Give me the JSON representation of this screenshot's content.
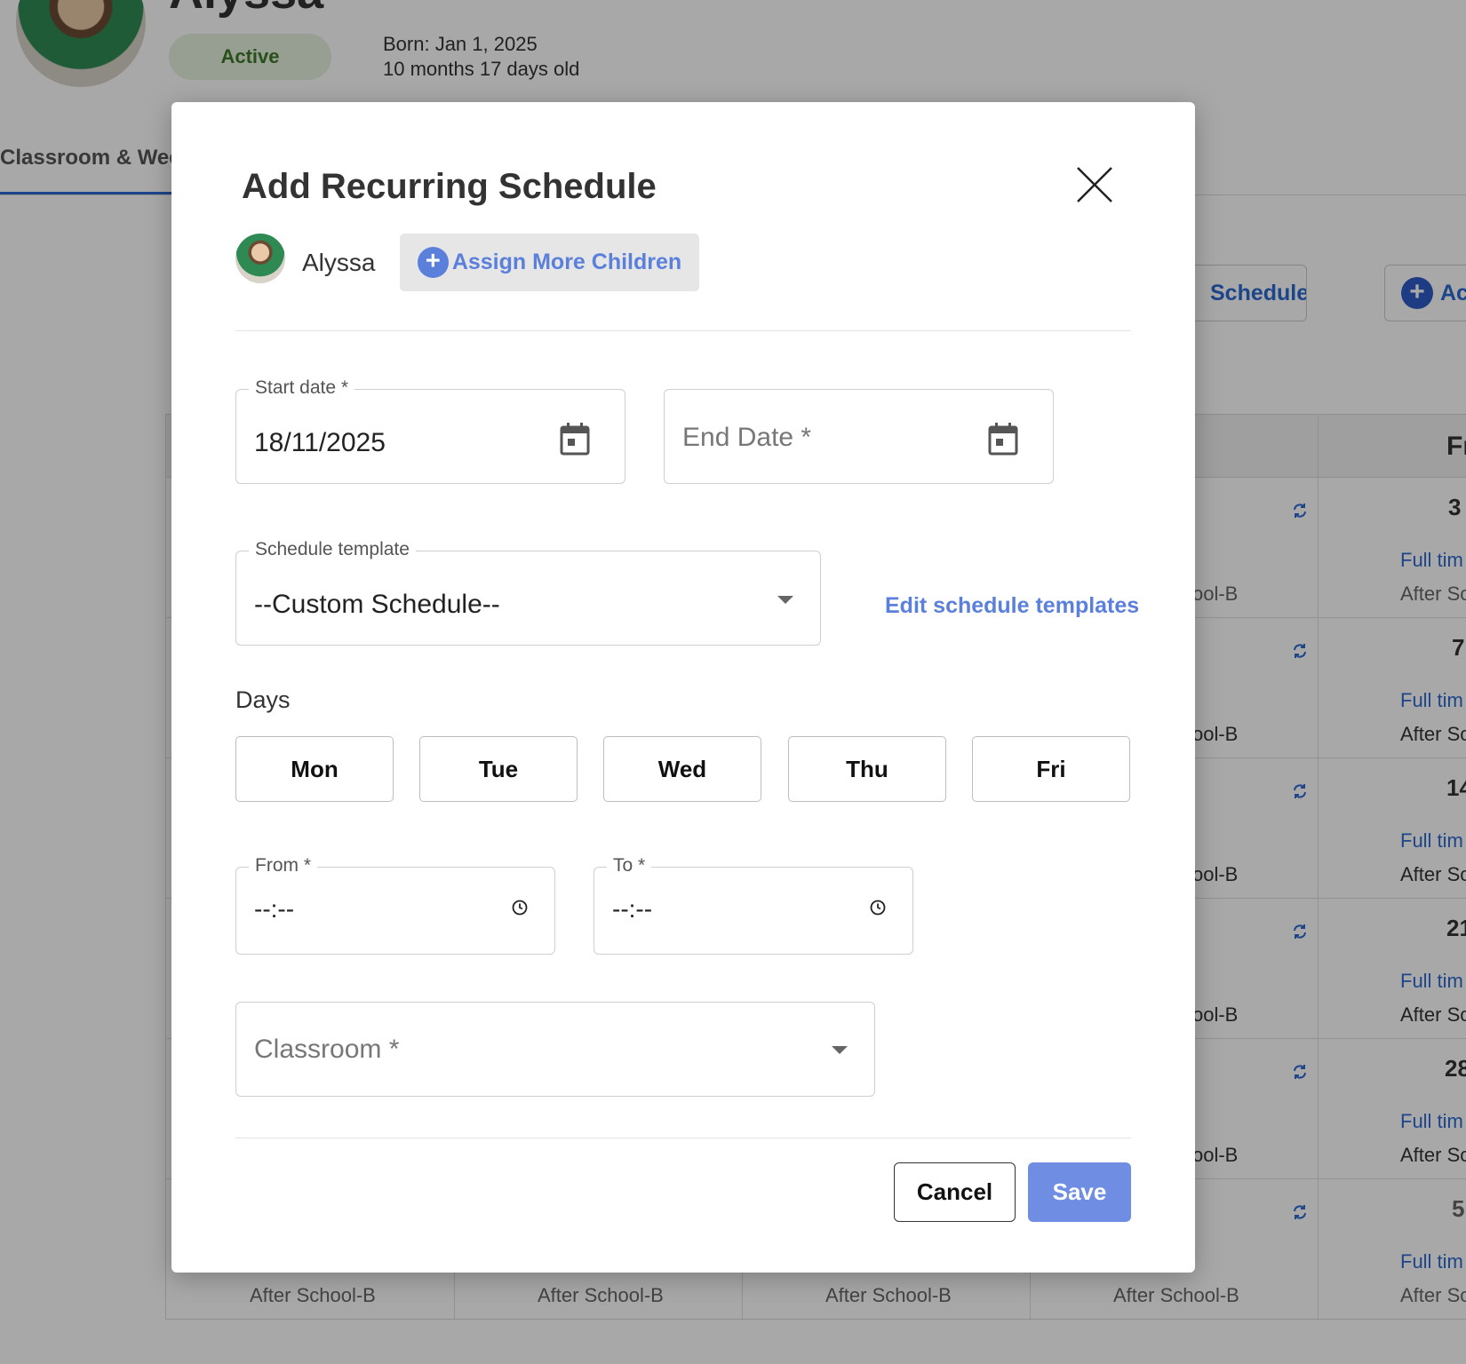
{
  "background": {
    "child_name": "Alyssa",
    "status": "Active",
    "born": "Born: Jan 1, 2025",
    "age": "10 months 17 days old",
    "tab_label": "Classroom & Wee",
    "schedule_button_label": "Schedule",
    "add_button_label": "Ac",
    "friday_header": "Fr",
    "day_numbers": [
      "3",
      "7",
      "14",
      "21",
      "28",
      "5"
    ],
    "cell_program": "Full tim",
    "cell_session": "After Sc",
    "cell_classroom_partial": "ool-B",
    "bottom_row_classrooms": [
      "After School-B",
      "After School-B",
      "After School-B",
      "After School-B"
    ]
  },
  "modal": {
    "title": "Add Recurring Schedule",
    "child_name": "Alyssa",
    "assign_more_label": "Assign More Children",
    "start_date": {
      "label": "Start date *",
      "value": "18/11/2025"
    },
    "end_date": {
      "placeholder": "End Date *"
    },
    "schedule_template": {
      "label": "Schedule template",
      "value": "--Custom Schedule--"
    },
    "edit_templates_link": "Edit schedule templates",
    "days_label": "Days",
    "days": [
      "Mon",
      "Tue",
      "Wed",
      "Thu",
      "Fri"
    ],
    "from": {
      "label": "From *",
      "value": "--:--"
    },
    "to": {
      "label": "To *",
      "value": "--:--"
    },
    "classroom": {
      "placeholder": "Classroom *"
    },
    "cancel_label": "Cancel",
    "save_label": "Save"
  },
  "colors": {
    "accent": "#5b80dc",
    "save_button": "#6f8ee3",
    "status_green": "#3f7a2a",
    "overlay": "rgba(0,0,0,0.34)"
  },
  "icons": [
    "close-icon",
    "plus-circle-icon",
    "calendar-icon",
    "chevron-down-icon",
    "clock-icon",
    "refresh-icon"
  ]
}
